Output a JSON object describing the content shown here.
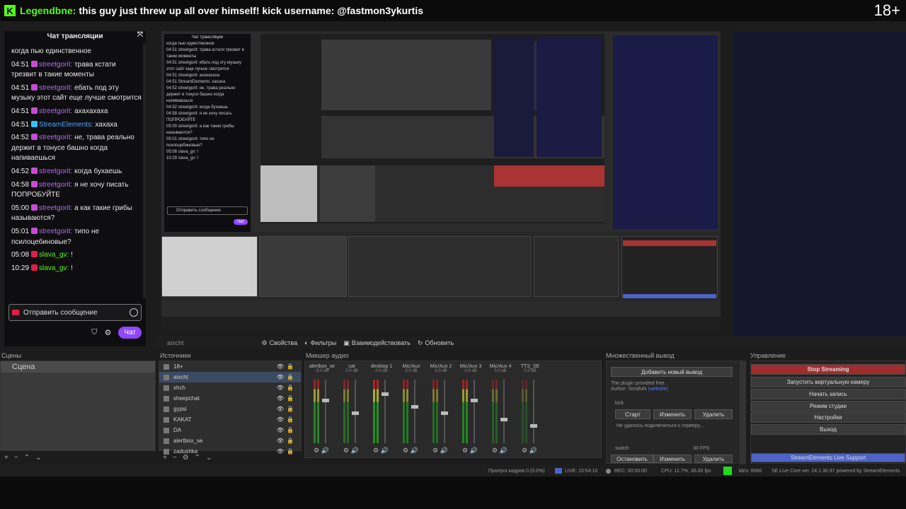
{
  "banner": {
    "logo": "K",
    "username": "Legendbne:",
    "message": "this guy just threw up all over himself! kick username: @fastmon3ykurtis",
    "age_rating": "18+"
  },
  "chat": {
    "title": "Чат трансляции",
    "close_icon": "⤧",
    "messages": [
      {
        "time": "",
        "user": "",
        "text": "когда пью единственное",
        "badge": "",
        "color": ""
      },
      {
        "time": "04:51",
        "user": "streetgorit:",
        "text": "трава кстати трезвит в такие моменты",
        "badge": "purple",
        "color": "purple"
      },
      {
        "time": "04:51",
        "user": "streetgorit:",
        "text": "ебать под эту музыку этот сайт еще лучше смотрится",
        "badge": "purple",
        "color": "purple"
      },
      {
        "time": "04:51",
        "user": "streetgorit:",
        "text": "ахахахаха",
        "badge": "purple",
        "color": "purple"
      },
      {
        "time": "04:51",
        "user": "StreamElements:",
        "text": "хахаха",
        "badge": "blue",
        "color": "blue"
      },
      {
        "time": "04:52",
        "user": "streetgorit:",
        "text": "не, трава реально держит в тонусе башно когда напиваешься",
        "badge": "purple",
        "color": "purple"
      },
      {
        "time": "04:52",
        "user": "streetgorit:",
        "text": "когда бухаешь",
        "badge": "purple",
        "color": "purple"
      },
      {
        "time": "04:58",
        "user": "streetgorit:",
        "text": "я не хочу писать ПОПРОБУЙТЕ",
        "badge": "purple",
        "color": "purple"
      },
      {
        "time": "05:00",
        "user": "streetgorit:",
        "text": "а как такие грибы называются?",
        "badge": "purple",
        "color": "purple"
      },
      {
        "time": "05:01",
        "user": "streetgorit:",
        "text": "типо не псилоцебиновые?",
        "badge": "purple",
        "color": "purple"
      },
      {
        "time": "05:08",
        "user": "slava_gv:",
        "text": "!",
        "badge": "red",
        "color": "green"
      },
      {
        "time": "10:29",
        "user": "slava_gv:",
        "text": "!",
        "badge": "red",
        "color": "green"
      }
    ],
    "input_placeholder": "Отправить сообщение",
    "send_label": "Чат",
    "shield_icon": "⛉",
    "gear_icon": "⚙"
  },
  "preview": {
    "chat_title": "Чат трансляции",
    "chat_lines": [
      "когда пью единственное",
      "04:51 streetgorit: трава кстати трезвит в такие моменты",
      "04:51 streetgorit: ебать под эту музыку этот сайт еще лучше смотрится",
      "04:51 streetgorit: ахахахаха",
      "04:51 StreamElements: хахаха",
      "04:52 streetgorit: не, трава реально держит в тонусе башно когда напиваешься",
      "04:52 streetgorit: когда бухаешь",
      "04:58 streetgorit: я не хочу писать ПОПРОБУЙТЕ",
      "05:00 streetgorit: а как такие грибы называются?",
      "05:01 streetgorit: типо не псилоцебиновые?",
      "05:08 slava_gv: !",
      "10:29 slava_gv: !"
    ],
    "chat_input": "Отправить сообщение",
    "send": "Чат"
  },
  "propbar": {
    "source": "aixcht",
    "properties": "Свойства",
    "filters": "Фильтры",
    "interact": "Взаимодействовать",
    "refresh": "Обновить"
  },
  "scenes": {
    "title": "Сцены",
    "items": [
      "Сцена"
    ]
  },
  "sources": {
    "title": "Источники",
    "items": [
      {
        "name": "18+",
        "selected": false
      },
      {
        "name": "aixcht",
        "selected": true
      },
      {
        "name": "shch",
        "selected": false
      },
      {
        "name": "sheepchat",
        "selected": false
      },
      {
        "name": "gypsi",
        "selected": false
      },
      {
        "name": "KAKAT",
        "selected": false
      },
      {
        "name": "DA",
        "selected": false
      },
      {
        "name": "alertbox_se",
        "selected": false
      },
      {
        "name": "zadushka",
        "selected": false
      }
    ]
  },
  "mixer": {
    "title": "Микшер аудио",
    "channels": [
      {
        "name": "alertbox_se",
        "db": "-5.0 dB",
        "level": 0.7
      },
      {
        "name": "cat",
        "db": "0.0 dB",
        "level": 0.5
      },
      {
        "name": "desktop 1",
        "db": "0.0 dB",
        "level": 0.8
      },
      {
        "name": "Mic/Aux",
        "db": "0.0 dB",
        "level": 0.6
      },
      {
        "name": "Mic/Aux 2",
        "db": "0.0 dB",
        "level": 0.5
      },
      {
        "name": "Mic/Aux 3",
        "db": "0.0 dB",
        "level": 0.7
      },
      {
        "name": "Mic/Aux 4",
        "db": "0.0 dB",
        "level": 0.4
      },
      {
        "name": "TTS_SE",
        "db": "0.0 dB",
        "level": 0.3
      }
    ]
  },
  "multi": {
    "title": "Множественный вывод",
    "add_button": "Добавить новый вывод",
    "note1": "The plugin provided free.",
    "note2": "Author: Sorafuhi",
    "author_link": "(website)",
    "kick": "kick",
    "start": "Старт",
    "edit": "Изменить",
    "delete": "Удалить",
    "error": "Не удалось подключиться к серверу...",
    "switch": "switch",
    "fps": "30 FPS",
    "stop": "Остановить",
    "edit2": "Изменить",
    "delete2": "Удалить"
  },
  "controls": {
    "title": "Управление",
    "stop_streaming": "Stop Streaming",
    "virtual_cam": "Запустить виртуальную камеру",
    "record": "Начать запись",
    "studio": "Режим студии",
    "settings": "Настройки",
    "exit": "Выход",
    "support": "StreamElements Live Support"
  },
  "status": {
    "dropped": "Пропуск кадров 0 (0.0%)",
    "live": "LIVE: 15:54:10",
    "rec": "REC: 00:00:00",
    "cpu": "CPU: 11.7%, 30.00 fps",
    "kbs": "kb/s: 6066",
    "version": "SE.Live Core ver. 24.1.30.97 powered by StreamElements"
  },
  "colors": {
    "kick_green": "#53fc18",
    "chat_purple": "#b46cf0",
    "stop_red": "#9f2d2d",
    "support_blue": "#4d63c7"
  }
}
